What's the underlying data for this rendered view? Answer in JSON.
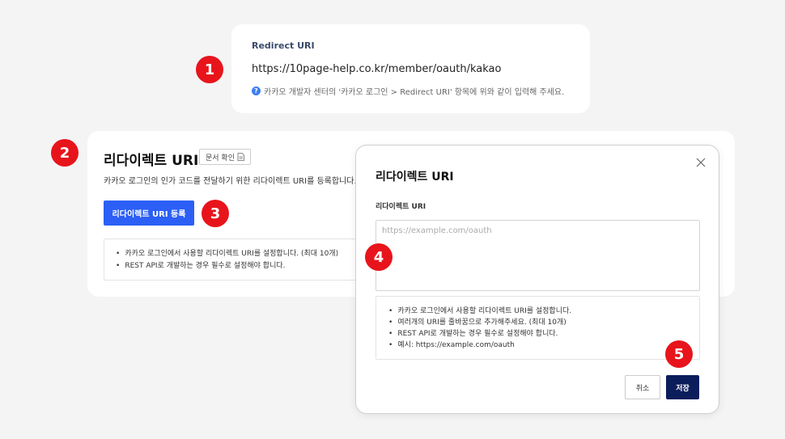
{
  "top_card": {
    "label": "Redirect URI",
    "url": "https://10page-help.co.kr/member/oauth/kakao",
    "hint_icon": "question-circle-icon",
    "hint": "카카오 개발자 센터의 '카카오 로그인 > Redirect URI' 항목에 위와 같이 입력해 주세요."
  },
  "main": {
    "title": "리다이렉트 URI",
    "doc_button": "문서 확인",
    "description": "카카오 로그인의 인가 코드를 전달하기 위한 리다이렉트 URI를 등록합니다.",
    "register_button": "리다이렉트 URI 등록",
    "info": [
      "카카오 로그인에서 사용할 리다이렉트 URI를 설정합니다. (최대 10개)",
      "REST API로 개발하는 경우 필수로 설정해야 합니다."
    ]
  },
  "modal": {
    "title": "리다이렉트 URI",
    "field_label": "리다이렉트 URI",
    "placeholder": "https://example.com/oauth",
    "info": [
      "카카오 로그인에서 사용할 리다이렉트 URI를 설정합니다.",
      "여러개의 URI를 줄바꿈으로 추가해주세요. (최대 10개)",
      "REST API로 개발하는 경우 필수로 설정해야 합니다.",
      "예시: https://example.com/oauth"
    ],
    "cancel": "취소",
    "save": "저장"
  },
  "badges": [
    "1",
    "2",
    "3",
    "4",
    "5"
  ],
  "colors": {
    "accent_blue": "#2b5ff5",
    "save_navy": "#0c1d5c",
    "badge_red": "#e8141b"
  }
}
